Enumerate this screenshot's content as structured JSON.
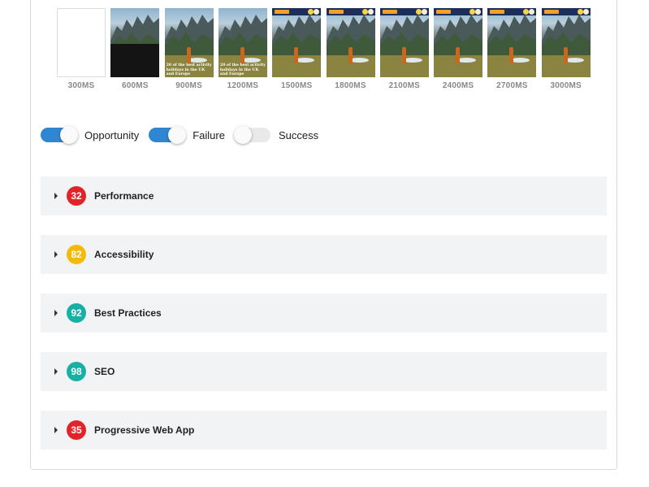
{
  "filmstrip": {
    "frames": [
      {
        "time": "300MS",
        "kind": "blank",
        "caption": ""
      },
      {
        "time": "600MS",
        "kind": "partial",
        "caption": ""
      },
      {
        "time": "900MS",
        "kind": "caption",
        "caption": "20 of the best activity holidays in the UK and Europe"
      },
      {
        "time": "1200MS",
        "kind": "caption",
        "caption": "20 of the best activity holidays in the UK and Europe"
      },
      {
        "time": "1500MS",
        "kind": "full",
        "caption": ""
      },
      {
        "time": "1800MS",
        "kind": "full",
        "caption": ""
      },
      {
        "time": "2100MS",
        "kind": "full",
        "caption": ""
      },
      {
        "time": "2400MS",
        "kind": "full",
        "caption": ""
      },
      {
        "time": "2700MS",
        "kind": "full",
        "caption": ""
      },
      {
        "time": "3000MS",
        "kind": "full",
        "caption": ""
      }
    ]
  },
  "toggles": [
    {
      "label": "Opportunity",
      "on": true
    },
    {
      "label": "Failure",
      "on": true
    },
    {
      "label": "Success",
      "on": false
    }
  ],
  "categories": [
    {
      "score": "32",
      "title": "Performance",
      "color": "#e0242a"
    },
    {
      "score": "82",
      "title": "Accessibility",
      "color": "#f5b90c"
    },
    {
      "score": "92",
      "title": "Best Practices",
      "color": "#18b0a5"
    },
    {
      "score": "98",
      "title": "SEO",
      "color": "#18b0a5"
    },
    {
      "score": "35",
      "title": "Progressive Web App",
      "color": "#e0242a"
    }
  ],
  "colors": {
    "accent": "#2f86d3",
    "panel": "#f2f3f5"
  }
}
